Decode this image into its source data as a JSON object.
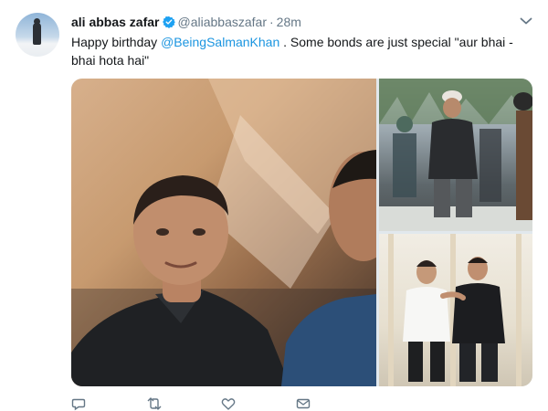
{
  "tweet": {
    "author": {
      "display_name": "ali abbas zafar",
      "handle": "@aliabbaszafar",
      "verified": true,
      "avatar_icon": "profile-photo"
    },
    "separator": "·",
    "time": "28m",
    "text": {
      "prefix": "Happy birthday ",
      "mention": "@BeingSalmanKhan",
      "suffix": " . Some bonds are just special \"aur bhai -bhai hota hai\""
    },
    "media": [
      {
        "name": "photo-main"
      },
      {
        "name": "photo-top-right"
      },
      {
        "name": "photo-bottom-right"
      }
    ],
    "actions": [
      {
        "icon": "reply-icon"
      },
      {
        "icon": "retweet-icon"
      },
      {
        "icon": "like-icon"
      },
      {
        "icon": "message-icon"
      }
    ]
  },
  "colors": {
    "link": "#1b95e0",
    "verified": "#1da1f2",
    "secondary_text": "#657786",
    "primary_text": "#14171a"
  }
}
